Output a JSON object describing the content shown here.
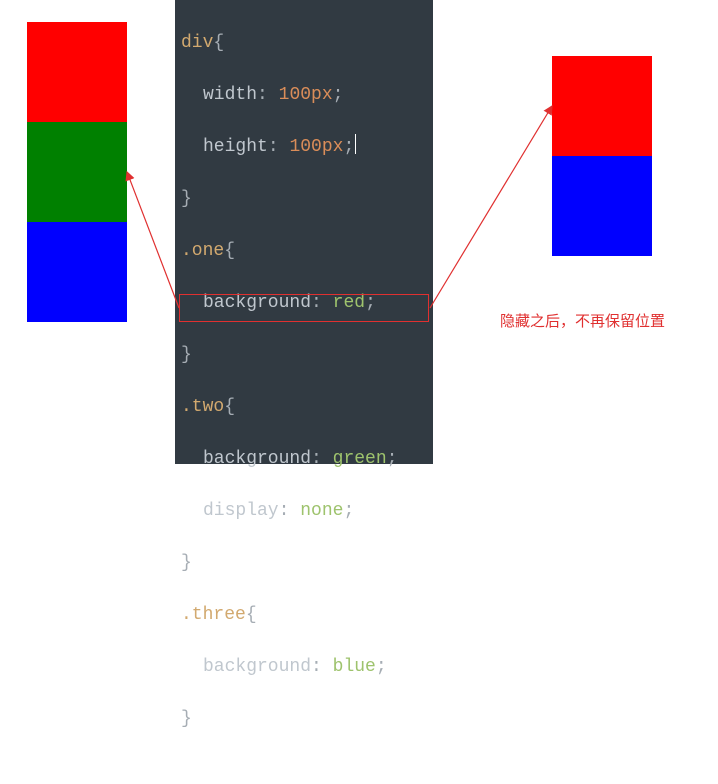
{
  "boxes": {
    "left_colors": [
      "#ff0000",
      "#008000",
      "#0000ff"
    ],
    "right_colors": [
      "#ff0000",
      "#0000ff"
    ]
  },
  "annotation": "隐藏之后，不再保留位置",
  "code": {
    "sel_div": "div",
    "brace_open": "{",
    "brace_close": "}",
    "prop_width": "width",
    "val_width": "100",
    "unit": "px",
    "prop_height": "height",
    "val_height": "100",
    "sel_one": ".one",
    "prop_bg": "background",
    "val_red": "red",
    "sel_two": ".two",
    "val_green": "green",
    "prop_display": "display",
    "val_none": "none",
    "sel_three": ".three",
    "val_blue": "blue",
    "colon": ":",
    "semi": ";"
  }
}
